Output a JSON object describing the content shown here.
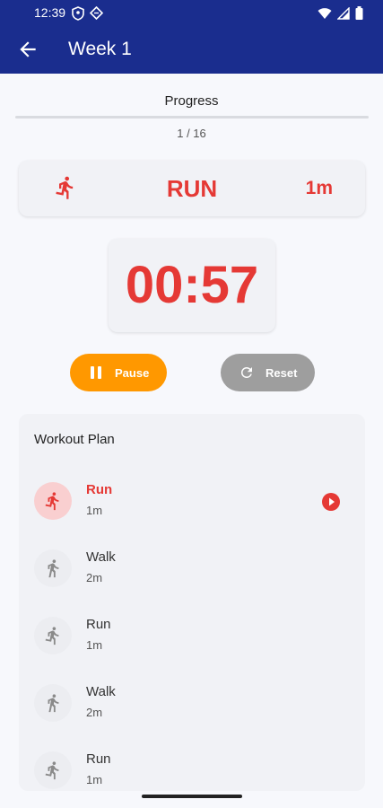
{
  "status_bar": {
    "time": "12:39",
    "left_icons": [
      "shield-icon",
      "diamond-icon"
    ],
    "right_icons": [
      "wifi-icon",
      "signal-icon",
      "battery-icon"
    ]
  },
  "app_bar": {
    "back_icon": "arrow-back-icon",
    "title": "Week 1",
    "color": "#1a2d8e"
  },
  "progress": {
    "label": "Progress",
    "count_text": "1 / 16",
    "fraction": 0.0
  },
  "current": {
    "icon": "running-icon",
    "activity": "RUN",
    "duration": "1m",
    "accent_color": "#e53935"
  },
  "timer": {
    "value": "00:57"
  },
  "controls": {
    "pause_label": "Pause",
    "pause_icon": "pause-icon",
    "pause_color": "#ff9800",
    "reset_label": "Reset",
    "reset_icon": "refresh-icon",
    "reset_color": "#9e9e9e"
  },
  "plan": {
    "title": "Workout Plan",
    "items": [
      {
        "name": "Run",
        "duration": "1m",
        "icon": "running-icon",
        "active": true,
        "playing_icon": "play-circle-icon"
      },
      {
        "name": "Walk",
        "duration": "2m",
        "icon": "walking-icon",
        "active": false
      },
      {
        "name": "Run",
        "duration": "1m",
        "icon": "running-icon",
        "active": false
      },
      {
        "name": "Walk",
        "duration": "2m",
        "icon": "walking-icon",
        "active": false
      },
      {
        "name": "Run",
        "duration": "1m",
        "icon": "running-icon",
        "active": false
      }
    ]
  }
}
